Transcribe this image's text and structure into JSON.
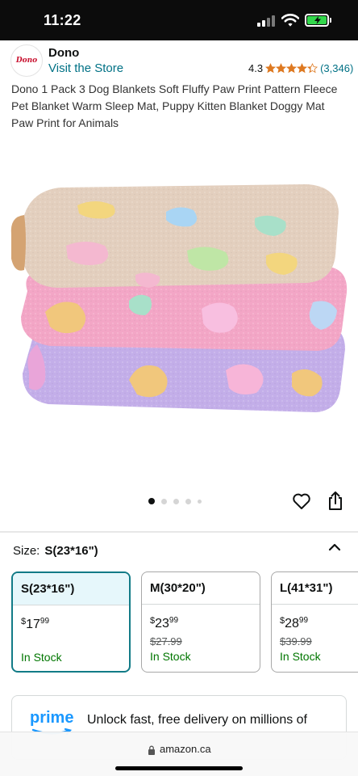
{
  "status_bar": {
    "time": "11:22"
  },
  "brand": {
    "logo_text": "Dono",
    "name": "Dono",
    "visit_store": "Visit the Store"
  },
  "rating": {
    "value": "4.3",
    "stars": 4.3,
    "count": "(3,346)"
  },
  "product": {
    "title": "Dono 1 Pack 3 Dog Blankets Soft Fluffy Paw Print Pattern Fleece Pet Blanket Warm Sleep Mat, Puppy Kitten Blanket Doggy Mat Paw Print for Animals",
    "image_icon": "folded-blankets-image",
    "image_colors": [
      "#e6d4c4",
      "#f2a9c8",
      "#c6b2eb"
    ]
  },
  "carousel": {
    "count": 5,
    "active_index": 0
  },
  "size": {
    "label": "Size:",
    "selected": "S(23*16\")"
  },
  "variants": [
    {
      "name": "S(23*16\")",
      "currency": "$",
      "price_whole": "17",
      "price_cents": "99",
      "list_price": "",
      "stock": "In Stock",
      "selected": true
    },
    {
      "name": "M(30*20\")",
      "currency": "$",
      "price_whole": "23",
      "price_cents": "99",
      "list_price": "$27.99",
      "stock": "In Stock",
      "selected": false
    },
    {
      "name": "L(41*31\")",
      "currency": "$",
      "price_whole": "28",
      "price_cents": "99",
      "list_price": "$39.99",
      "stock": "In Stock",
      "selected": false
    }
  ],
  "prime": {
    "logo": "prime",
    "text": "Unlock fast, free delivery on millions of"
  },
  "browser": {
    "url": "amazon.ca"
  },
  "colors": {
    "link": "#007185",
    "star": "#de7921",
    "in_stock": "#007600",
    "selected_border": "#127b87",
    "prime_blue": "#1a98ff"
  }
}
